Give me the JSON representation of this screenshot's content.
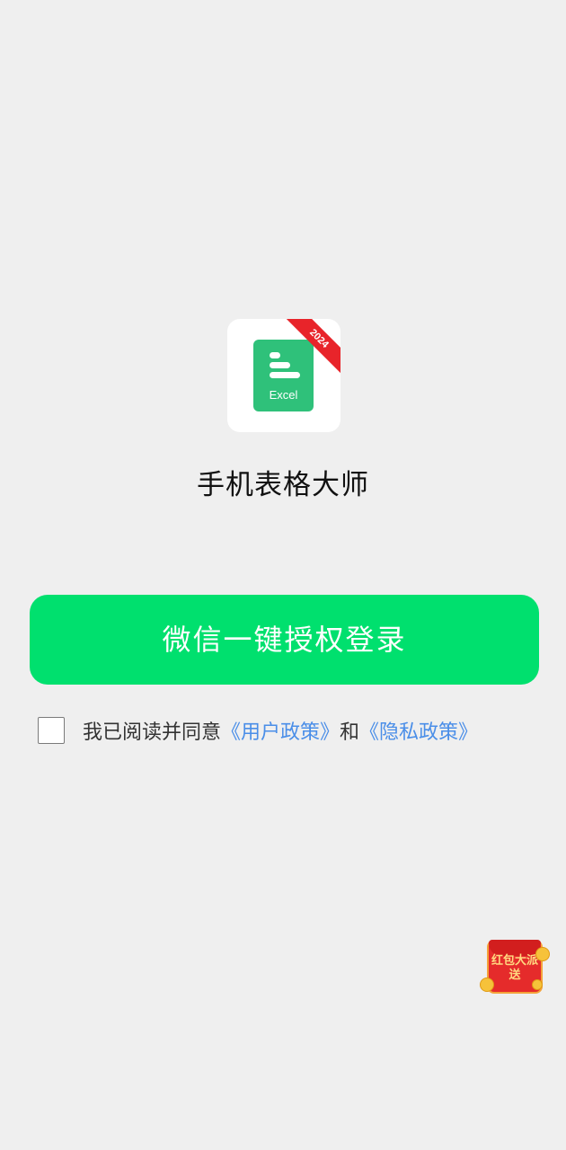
{
  "app": {
    "icon": {
      "doc_label": "Excel",
      "ribbon_text": "2024",
      "doc_color": "#2fc17a",
      "ribbon_color": "#e8242a"
    },
    "title": "手机表格大师"
  },
  "login": {
    "button_label": "微信一键授权登录",
    "button_color": "#00e06e"
  },
  "agreement": {
    "checked": false,
    "prefix": "我已阅读并同意",
    "user_policy_link": "《用户政策》",
    "conjunction": "和",
    "privacy_policy_link": "《隐私政策》",
    "link_color": "#4a8ee8"
  },
  "red_packet": {
    "label": "红包大派送",
    "icon": "red-packet-icon"
  }
}
